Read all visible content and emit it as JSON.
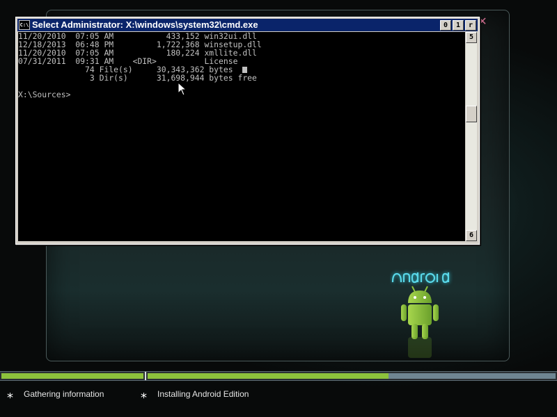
{
  "cmd": {
    "title": "Select Administrator: X:\\windows\\system32\\cmd.exe",
    "icon_label": "C:\\",
    "controls": {
      "minimize": "0",
      "maximize": "1",
      "close": "r"
    },
    "scroll_up": "5",
    "scroll_down": "6",
    "lines": [
      "11/20/2010  07:05 AM           433,152 win32ui.dll",
      "12/18/2013  06:48 PM         1,722,368 winsetup.dll",
      "11/20/2010  07:05 AM           180,224 xmllite.dll",
      "07/31/2011  09:31 AM    <DIR>          License",
      "              74 File(s)     30,343,362 bytes",
      "               3 Dir(s)      31,698,944 bytes free",
      "",
      "X:\\Sources>"
    ]
  },
  "branding": {
    "wordmark": "ANDROID",
    "accent": "#59d7e8",
    "bot_color": "#8dc23c"
  },
  "close_icon": "✕",
  "progress": {
    "overall_fill": 0.59
  },
  "status": {
    "step1": "Gathering information",
    "step2": "Installing Android Edition",
    "bullet": "*"
  }
}
